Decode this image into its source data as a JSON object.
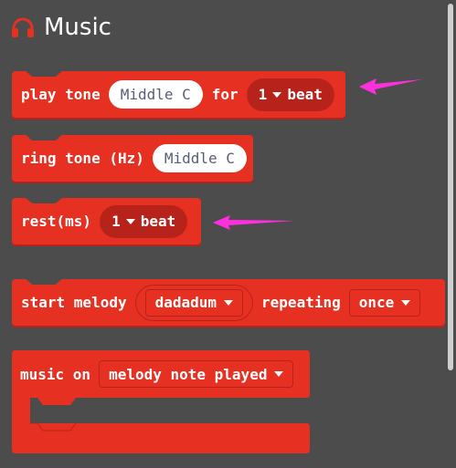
{
  "category": {
    "title": "Music",
    "icon": "headphones-icon",
    "color": "#e63022"
  },
  "blocks": {
    "play_tone": {
      "label1": "play tone",
      "note": "Middle C",
      "label2": "for",
      "beat_value": "1",
      "beat_unit": "beat"
    },
    "ring_tone": {
      "label": "ring tone (Hz)",
      "note": "Middle C"
    },
    "rest": {
      "label": "rest(ms)",
      "beat_value": "1",
      "beat_unit": "beat"
    },
    "start_melody": {
      "label1": "start melody",
      "melody": "dadadum",
      "label2": "repeating",
      "repeat": "once"
    },
    "music_on": {
      "label": "music on",
      "event": "melody note played"
    }
  },
  "annotations": {
    "arrow_color": "#ff2fe0"
  }
}
